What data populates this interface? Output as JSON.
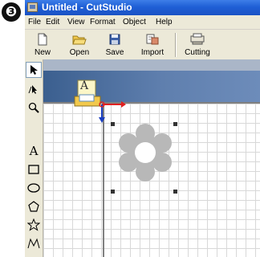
{
  "step_number": "❸",
  "window": {
    "title": "Untitled - CutStudio"
  },
  "menubar": {
    "items": [
      {
        "label": "File"
      },
      {
        "label": "Edit"
      },
      {
        "label": "View"
      },
      {
        "label": "Format"
      },
      {
        "label": "Object"
      },
      {
        "label": "Help"
      }
    ]
  },
  "toolbar": {
    "buttons": [
      {
        "label": "New",
        "icon": "new-document-icon"
      },
      {
        "label": "Open",
        "icon": "open-folder-icon"
      },
      {
        "label": "Save",
        "icon": "floppy-disk-icon"
      },
      {
        "label": "Import",
        "icon": "import-icon"
      },
      {
        "label": "Cutting",
        "icon": "cutting-icon"
      }
    ]
  },
  "tools": [
    {
      "name": "select-arrow-icon",
      "selected": true
    },
    {
      "name": "node-edit-icon"
    },
    {
      "name": "zoom-magnifier-icon"
    },
    {
      "name": "text-tool-icon",
      "glyph": "A"
    },
    {
      "name": "rectangle-tool-icon"
    },
    {
      "name": "ellipse-tool-icon"
    },
    {
      "name": "pentagon-tool-icon"
    },
    {
      "name": "star-tool-icon"
    },
    {
      "name": "freehand-tool-icon"
    }
  ],
  "image_label": "A",
  "colors": {
    "titlebar": "#1f5fd6",
    "chrome": "#ece9d8",
    "workspace": "#5f7fae",
    "flower": "#b8b8b8",
    "axis_x": "#e02020",
    "axis_y": "#1a3ec0"
  }
}
